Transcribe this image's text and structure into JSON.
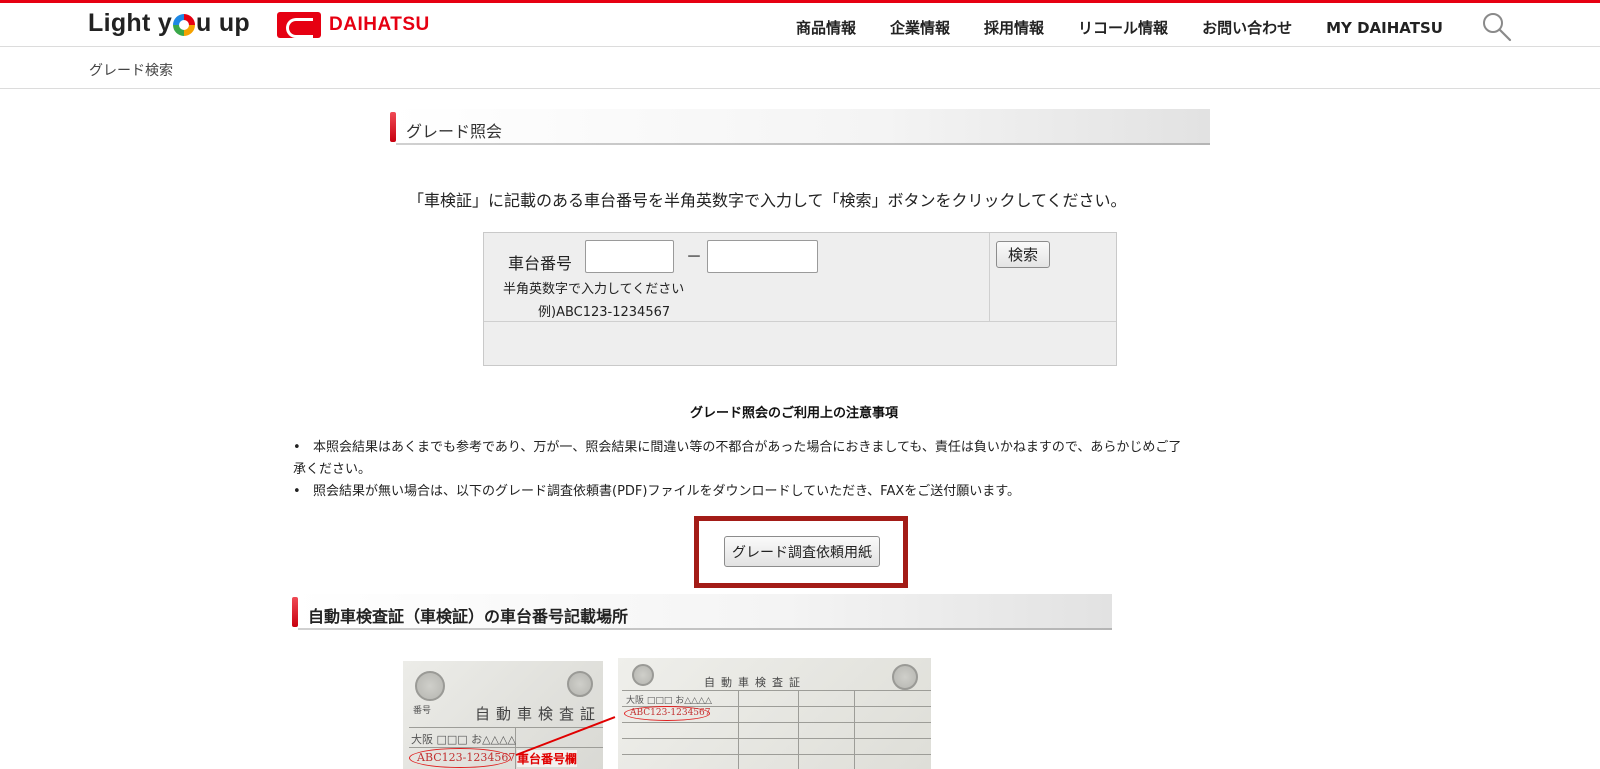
{
  "header": {
    "tagline_pre": "Light y",
    "tagline_post": "u up",
    "brand_name": "DAIHATSU",
    "nav": [
      "商品情報",
      "企業情報",
      "採用情報",
      "リコール情報",
      "お問い合わせ",
      "MY DAIHATSU"
    ],
    "search_icon": "search-icon"
  },
  "breadcrumb": "グレード検索",
  "section1": {
    "title": "グレード照会"
  },
  "instruction": "「車検証」に記載のある車台番号を半角英数字で入力して「検索」ボタンをクリックしてください。",
  "form": {
    "label": "車台番号",
    "input1_value": "",
    "input2_value": "",
    "dash": "－",
    "hint": "半角英数字で入力してください",
    "example": "例)ABC123-1234567",
    "search_button": "検索"
  },
  "notice": {
    "title": "グレード照会のご利用上の注意事項",
    "item1_line1": "本照会結果はあくまでも参考であり、万が一、照会結果に間違い等の不都合があった場合におきましても、責任は負いかねますので、あらかじめご了",
    "item1_line2": "承ください。",
    "item2": "照会結果が無い場合は、以下のグレード調査依頼書(PDF)ファイルをダウンロードしていただき、FAXをご送付願います。"
  },
  "pdf_button": "グレード調査依頼用紙",
  "section2": {
    "title": "自動車検査証（車検証）の車台番号記載場所"
  },
  "cert_images": {
    "left_title": "自動車検査証",
    "left_label_bango": "番号",
    "left_plate": "大阪 □□□ お△△△△",
    "left_number": "ABC123-1234567",
    "left_label": "車台番号欄",
    "right_title": "自動車検査証",
    "right_plate": "大阪 □□□ お△△△△",
    "right_number": "ABC123-1234567"
  }
}
